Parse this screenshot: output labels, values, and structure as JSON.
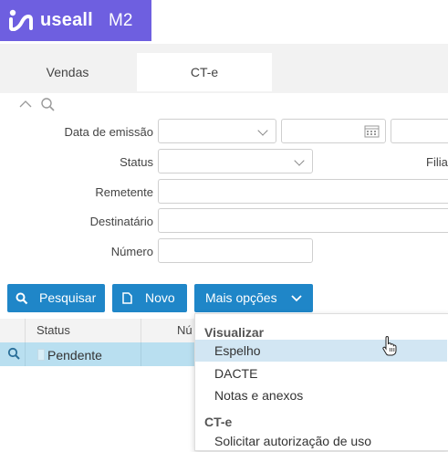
{
  "app": {
    "logo_text": "useall",
    "logo_version": "M2"
  },
  "tabs": [
    {
      "label": "Vendas"
    },
    {
      "label": "CT-e"
    }
  ],
  "filters": {
    "data_emissao_label": "Data de emissão",
    "status_label": "Status",
    "filial_label": "Filia",
    "remetente_label": "Remetente",
    "destinatario_label": "Destinatário",
    "numero_label": "Número"
  },
  "toolbar": {
    "pesquisar_label": "Pesquisar",
    "novo_label": "Novo",
    "mais_opcoes_label": "Mais opções"
  },
  "grid": {
    "columns": [
      "Status",
      "Nú"
    ],
    "rows": [
      {
        "status": "Pendente"
      }
    ]
  },
  "menu": {
    "group1": "Visualizar",
    "items1": [
      "Espelho",
      "DACTE",
      "Notas e anexos"
    ],
    "group2": "CT-e",
    "items2": [
      "Solicitar autorização de uso"
    ]
  },
  "colors": {
    "brand": "#6e5fe0",
    "button": "#1f86c8",
    "selected_row": "#b9dff0",
    "menu_highlight": "#d2e6f3"
  }
}
